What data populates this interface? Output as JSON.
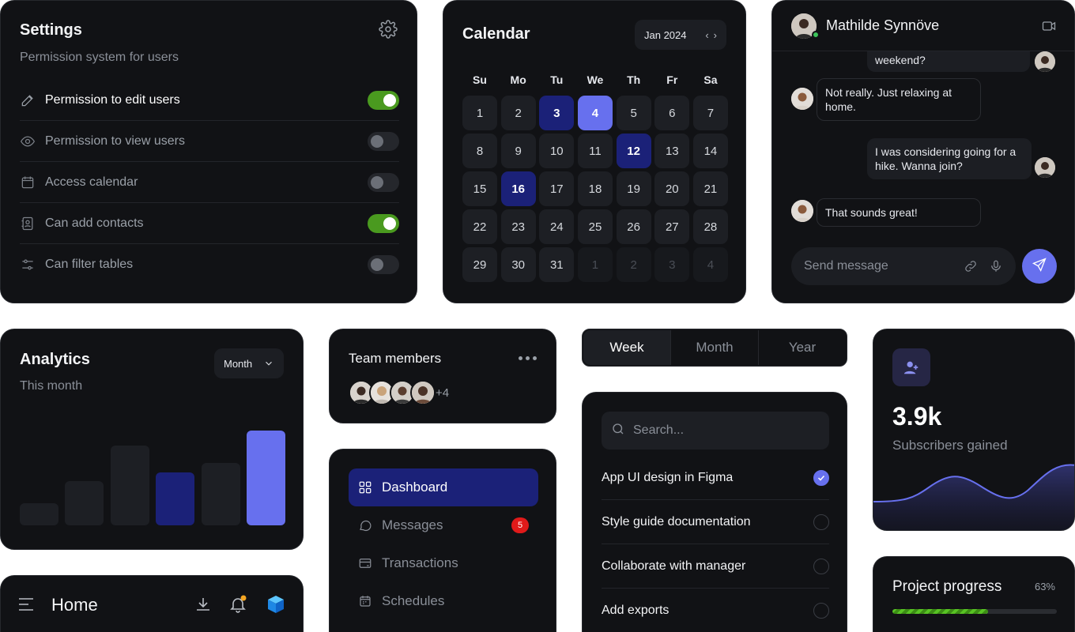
{
  "settings": {
    "title": "Settings",
    "subtitle": "Permission system for users",
    "permissions": [
      {
        "label": "Permission to edit users",
        "icon": "pencil-icon",
        "on": true
      },
      {
        "label": "Permission to view users",
        "icon": "eye-icon",
        "on": false
      },
      {
        "label": "Access calendar",
        "icon": "calendar-icon",
        "on": false
      },
      {
        "label": "Can add contacts",
        "icon": "contact-book-icon",
        "on": true
      },
      {
        "label": "Can filter tables",
        "icon": "sliders-icon",
        "on": false
      }
    ]
  },
  "calendar": {
    "title": "Calendar",
    "month": "Jan 2024",
    "weekdays": [
      "Su",
      "Mo",
      "Tu",
      "We",
      "Th",
      "Fr",
      "Sa"
    ],
    "days": [
      {
        "n": "1"
      },
      {
        "n": "2"
      },
      {
        "n": "3",
        "hl": "dark"
      },
      {
        "n": "4",
        "hl": "bright"
      },
      {
        "n": "5"
      },
      {
        "n": "6"
      },
      {
        "n": "7"
      },
      {
        "n": "8"
      },
      {
        "n": "9"
      },
      {
        "n": "10"
      },
      {
        "n": "11"
      },
      {
        "n": "12",
        "hl": "dark"
      },
      {
        "n": "13"
      },
      {
        "n": "14"
      },
      {
        "n": "15"
      },
      {
        "n": "16",
        "hl": "dark"
      },
      {
        "n": "17"
      },
      {
        "n": "18"
      },
      {
        "n": "19"
      },
      {
        "n": "20"
      },
      {
        "n": "21"
      },
      {
        "n": "22"
      },
      {
        "n": "23"
      },
      {
        "n": "24"
      },
      {
        "n": "25"
      },
      {
        "n": "26"
      },
      {
        "n": "27"
      },
      {
        "n": "28"
      },
      {
        "n": "29"
      },
      {
        "n": "30"
      },
      {
        "n": "31"
      },
      {
        "n": "1",
        "out": true
      },
      {
        "n": "2",
        "out": true
      },
      {
        "n": "3",
        "out": true
      },
      {
        "n": "4",
        "out": true
      }
    ]
  },
  "chat": {
    "name": "Mathilde Synnöve",
    "messages": [
      {
        "text": "weekend?",
        "side": "out"
      },
      {
        "text": "Not really. Just relaxing at home.",
        "side": "in"
      },
      {
        "text": "I was considering going for a hike. Wanna join?",
        "side": "out"
      },
      {
        "text": "That sounds great!",
        "side": "in"
      }
    ],
    "placeholder": "Send message"
  },
  "analytics": {
    "title": "Analytics",
    "subtitle": "This month",
    "period": "Month",
    "bars": [
      {
        "value": 28,
        "color": "#1d1f24"
      },
      {
        "value": 56,
        "color": "#1d1f24"
      },
      {
        "value": 101,
        "color": "#1d1f24"
      },
      {
        "value": 67,
        "color": "#1b2178"
      },
      {
        "value": 79,
        "color": "#1d1f24"
      },
      {
        "value": 120,
        "color": "#6770ee"
      }
    ]
  },
  "home": {
    "title": "Home",
    "accent": "#f5a623"
  },
  "team": {
    "title": "Team members",
    "more": "+4"
  },
  "nav": {
    "items": [
      {
        "label": "Dashboard",
        "icon": "grid-icon",
        "active": true
      },
      {
        "label": "Messages",
        "icon": "chat-bubble-icon",
        "badge": "5"
      },
      {
        "label": "Transactions",
        "icon": "card-icon"
      },
      {
        "label": "Schedules",
        "icon": "calendar-icon"
      }
    ]
  },
  "segmented": {
    "options": [
      "Week",
      "Month",
      "Year"
    ],
    "selected": "Week"
  },
  "tasks": {
    "search_placeholder": "Search...",
    "items": [
      {
        "label": "App UI design in Figma",
        "done": true
      },
      {
        "label": "Style guide documentation",
        "done": false
      },
      {
        "label": "Collaborate with manager",
        "done": false
      },
      {
        "label": "Add exports",
        "done": false
      }
    ]
  },
  "subscribers": {
    "value": "3.9k",
    "label": "Subscribers gained"
  },
  "progress": {
    "title": "Project progress",
    "percent_label": "63%",
    "fraction": 0.58
  }
}
